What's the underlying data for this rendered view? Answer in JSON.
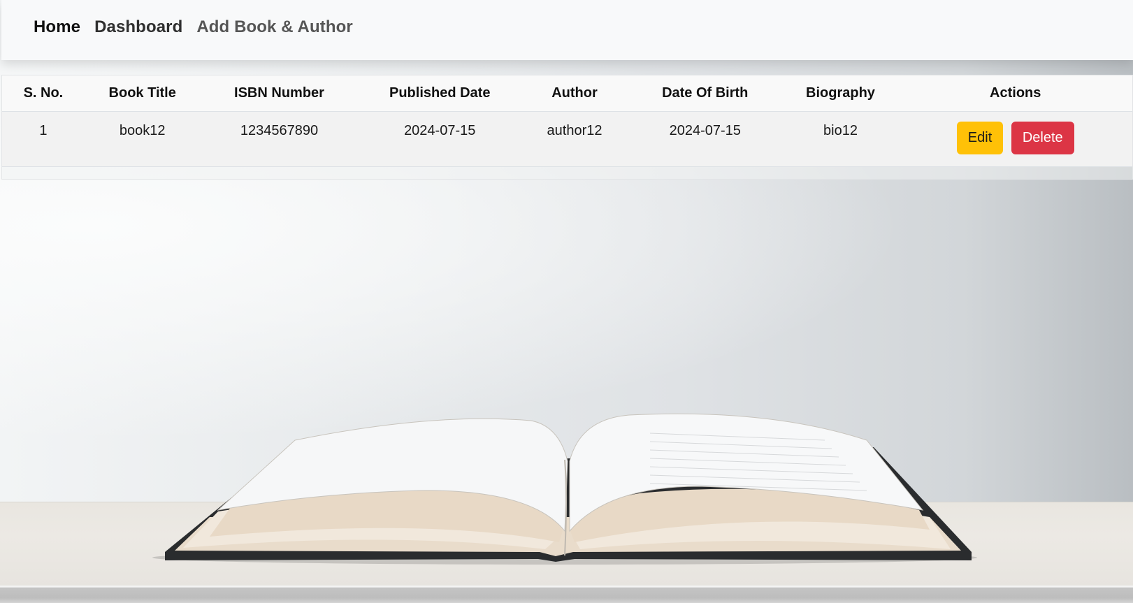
{
  "nav": {
    "brand": "Home",
    "links": [
      "Dashboard",
      "Add Book & Author"
    ]
  },
  "table": {
    "headers": [
      "S. No.",
      "Book Title",
      "ISBN Number",
      "Published Date",
      "Author",
      "Date Of Birth",
      "Biography",
      "Actions"
    ],
    "rows": [
      {
        "sno": "1",
        "title": "book12",
        "isbn": "1234567890",
        "published": "2024-07-15",
        "author": "author12",
        "dob": "2024-07-15",
        "bio": "bio12",
        "edit_label": "Edit",
        "delete_label": "Delete"
      }
    ]
  },
  "colors": {
    "edit_button": "#ffc107",
    "delete_button": "#dc3545",
    "navbar_bg": "#f8f9fa"
  },
  "background": {
    "image": "open-book-on-table"
  }
}
